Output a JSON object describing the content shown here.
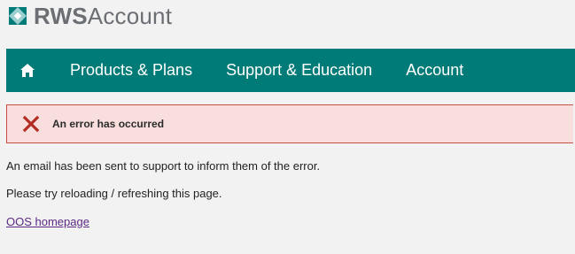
{
  "brand": {
    "name_bold": "RWS",
    "name_light": "Account",
    "logo_icon": "rws-logo-icon",
    "colors": {
      "mark_teal": "#007b77",
      "mark_light": "#9ccfcf",
      "text": "#6b6e73"
    }
  },
  "navbar": {
    "home_icon": "home-icon",
    "background": "#007b77",
    "items": [
      {
        "label": "Products & Plans"
      },
      {
        "label": "Support & Education"
      },
      {
        "label": "Account"
      }
    ]
  },
  "alert": {
    "icon": "error-x-icon",
    "message": "An error has occurred",
    "colors": {
      "background": "#f8dedc",
      "border": "#c94d45",
      "icon": "#b22d24"
    }
  },
  "body": {
    "line1": "An email has been sent to support to inform them of the error.",
    "line2": "Please try reloading / refreshing this page.",
    "homepage_link": "OOS homepage"
  }
}
